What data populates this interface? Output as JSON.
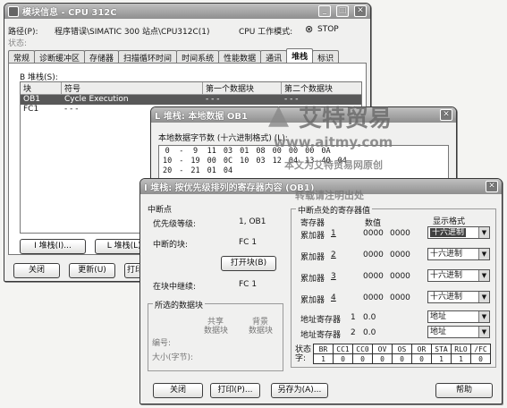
{
  "main": {
    "title": "模块信息 - CPU 312C",
    "path_label": "路径(P):",
    "path_value": "程序错误\\SIMATIC 300 站点\\CPU312C(1)",
    "mode_label": "CPU 工作模式:",
    "mode_value": "STOP",
    "status_label": "状态:",
    "tabs": [
      "常规",
      "诊断缓冲区",
      "存储器",
      "扫描循环时间",
      "时间系统",
      "性能数据",
      "通讯",
      "堆栈",
      "标识"
    ],
    "active_tab": 7,
    "bstack_label": "B 堆栈(S):",
    "list_headers": [
      "块",
      "符号",
      "第一个数据块",
      "第二个数据块"
    ],
    "list_rows": [
      {
        "block": "OB1",
        "symbol": "Cycle Execution",
        "db1": "- - -",
        "db2": "- - -"
      },
      {
        "block": "FC1",
        "symbol": "- - -",
        "db1": "",
        "db2": ""
      }
    ],
    "btn_istack": "I 堆栈(I)...",
    "btn_lstack": "L 堆栈(L)...",
    "btn_close": "关闭",
    "btn_update": "更新(U)",
    "btn_print": "打印"
  },
  "lstack": {
    "title": "L 堆栈: 本地数据 OB1",
    "bytes_label": "本地数据字节数 (十六进制格式) (L):",
    "rows": [
      {
        "a": "0",
        "b": "-",
        "c": "9",
        "vals": [
          "11",
          "03",
          "01",
          "08",
          "00",
          "00",
          "00",
          "0A"
        ]
      },
      {
        "a": "10",
        "b": "-",
        "c": "19",
        "vals": [
          "00",
          "0C",
          "10",
          "03",
          "12",
          "04",
          "13",
          "40",
          "04"
        ]
      },
      {
        "a": "20",
        "b": "-",
        "c": "21",
        "vals": [
          "01",
          "04"
        ]
      }
    ]
  },
  "istack": {
    "title": "I 堆栈: 按优先级排列的寄存器内容 (OB1)",
    "interrupt_point": "中断点",
    "priority_label": "优先级等级:",
    "priority_value": "1, OB1",
    "int_block_label": "中断的块:",
    "int_block_value": "FC 1",
    "open_block_btn": "打开块(B)",
    "continue_label": "在块中继续:",
    "continue_value": "FC 1",
    "selected_db": "所选的数据块",
    "db_left_label": "共享",
    "db_right_label": "背景",
    "db_sub_left": "数据块",
    "db_sub_right": "数据块",
    "number_label": "编号:",
    "size_label": "大小(字节):",
    "regs_title": "中断点处的寄存器值",
    "col_register": "寄存器",
    "col_value": "数值",
    "col_format": "显示格式",
    "registers": [
      {
        "name": "累加器",
        "idx": "1",
        "v1": "0000",
        "v2": "0000",
        "fmt": "十六进制"
      },
      {
        "name": "累加器",
        "idx": "2",
        "v1": "0000",
        "v2": "0000",
        "fmt": "十六进制"
      },
      {
        "name": "累加器",
        "idx": "3",
        "v1": "0000",
        "v2": "0000",
        "fmt": "十六进制"
      },
      {
        "name": "累加器",
        "idx": "4",
        "v1": "0000",
        "v2": "0000",
        "fmt": "十六进制"
      }
    ],
    "addr_regs": [
      {
        "name": "地址寄存器",
        "idx": "1",
        "v": "0.0",
        "fmt": "地址"
      },
      {
        "name": "地址寄存器",
        "idx": "2",
        "v": "0.0",
        "fmt": "地址"
      }
    ],
    "status_label": "状态字:",
    "status_headers": [
      "BR",
      "CC1",
      "CC0",
      "OV",
      "OS",
      "OR",
      "STA",
      "RLO",
      "/FC"
    ],
    "status_values": [
      "1",
      "0",
      "0",
      "0",
      "0",
      "0",
      "1",
      "1",
      "0"
    ],
    "btn_close": "关闭",
    "btn_print": "打印(P)...",
    "btn_saveas": "另存为(A)...",
    "btn_help": "帮助"
  },
  "watermark": {
    "brand": "艾特贸易",
    "url": "www.aitmy.com",
    "line1": "本文为艾特贸易网原创",
    "line2": "转载请注明出处"
  }
}
